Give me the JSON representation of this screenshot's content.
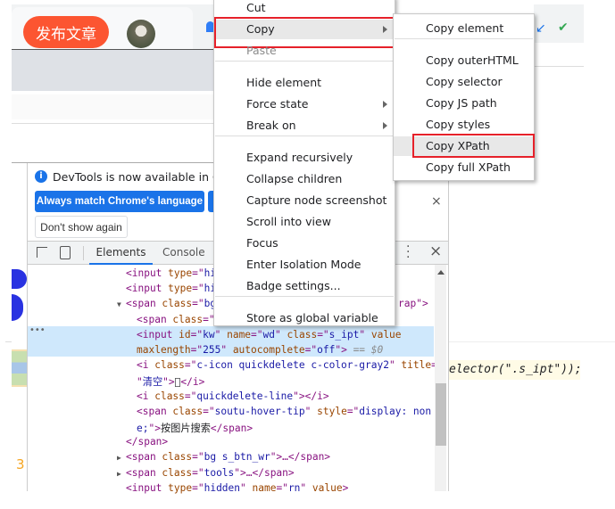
{
  "browser": {
    "publish_button": "发布文章"
  },
  "devtools": {
    "info_text": "DevTools is now available in Chine",
    "always_match_button": "Always match Chrome's language",
    "dont_show_button": "Don't show again",
    "tabs": [
      {
        "label": "Elements",
        "active": true
      },
      {
        "label": "Console",
        "active": false
      }
    ],
    "code_lines": [
      {
        "indent": 1,
        "tokens": [
          [
            "t",
            "<input "
          ],
          [
            "an",
            "type"
          ],
          [
            "t",
            "=\""
          ],
          [
            "av",
            "hi"
          ]
        ]
      },
      {
        "indent": 1,
        "tokens": [
          [
            "t",
            "<input "
          ],
          [
            "an",
            "type"
          ],
          [
            "t",
            "=\""
          ],
          [
            "av",
            "hi"
          ]
        ]
      },
      {
        "indent": 1,
        "expander": "open",
        "tokens": [
          [
            "t",
            "<span "
          ],
          [
            "an",
            "class"
          ],
          [
            "t",
            "=\""
          ],
          [
            "av",
            "bg"
          ]
        ],
        "tail": "rap\">"
      },
      {
        "indent": 2,
        "tokens": [
          [
            "t",
            "<span "
          ],
          [
            "an",
            "class"
          ],
          [
            "t",
            "=\""
          ]
        ]
      },
      {
        "indent": 2,
        "selected": true,
        "tokens": [
          [
            "t",
            "<input "
          ],
          [
            "an",
            "id"
          ],
          [
            "t",
            "=\""
          ],
          [
            "av",
            "kw"
          ],
          [
            "t",
            "\" "
          ],
          [
            "an",
            "name"
          ],
          [
            "t",
            "=\""
          ],
          [
            "av",
            "wd"
          ],
          [
            "t",
            "\" "
          ],
          [
            "an",
            "class"
          ],
          [
            "t",
            "=\""
          ],
          [
            "av",
            "s_ipt"
          ],
          [
            "t",
            "\" "
          ],
          [
            "an",
            "value"
          ]
        ]
      },
      {
        "indent": 2,
        "selected": true,
        "tokens": [
          [
            "an",
            "maxlength"
          ],
          [
            "t",
            "=\""
          ],
          [
            "av",
            "255"
          ],
          [
            "t",
            "\" "
          ],
          [
            "an",
            "autocomplete"
          ],
          [
            "t",
            "=\""
          ],
          [
            "av",
            "off"
          ],
          [
            "t",
            "\">"
          ],
          [
            "dim",
            " == $0"
          ]
        ]
      },
      {
        "indent": 2,
        "tokens": [
          [
            "t",
            "<i "
          ],
          [
            "an",
            "class"
          ],
          [
            "t",
            "=\""
          ],
          [
            "av",
            "c-icon quickdelete c-color-gray2"
          ],
          [
            "t",
            "\" "
          ],
          [
            "an",
            "title"
          ],
          [
            "t",
            "="
          ]
        ]
      },
      {
        "indent": 2,
        "tokens": [
          [
            "t",
            "\""
          ],
          [
            "av",
            "清空"
          ],
          [
            "t",
            "\">"
          ],
          [
            "tx",
            ""
          ],
          [
            "t",
            "</i>"
          ]
        ]
      },
      {
        "indent": 2,
        "tokens": [
          [
            "t",
            "<i "
          ],
          [
            "an",
            "class"
          ],
          [
            "t",
            "=\""
          ],
          [
            "av",
            "quickdelete-line"
          ],
          [
            "t",
            "\"></i>"
          ]
        ]
      },
      {
        "indent": 2,
        "tokens": [
          [
            "t",
            "<span "
          ],
          [
            "an",
            "class"
          ],
          [
            "t",
            "=\""
          ],
          [
            "av",
            "soutu-hover-tip"
          ],
          [
            "t",
            "\" "
          ],
          [
            "an",
            "style"
          ],
          [
            "t",
            "=\""
          ],
          [
            "av",
            "display: non"
          ]
        ]
      },
      {
        "indent": 2,
        "tokens": [
          [
            "av",
            "e;"
          ],
          [
            "t",
            "\">"
          ],
          [
            "tx",
            "按图片搜索"
          ],
          [
            "t",
            "</span>"
          ]
        ]
      },
      {
        "indent": 1,
        "tokens": [
          [
            "t",
            "</span>"
          ]
        ]
      },
      {
        "indent": 1,
        "expander": "closed",
        "tokens": [
          [
            "t",
            "<span "
          ],
          [
            "an",
            "class"
          ],
          [
            "t",
            "=\""
          ],
          [
            "av",
            "bg s_btn_wr"
          ],
          [
            "t",
            "\">…</span>"
          ]
        ]
      },
      {
        "indent": 1,
        "expander": "closed",
        "tokens": [
          [
            "t",
            "<span "
          ],
          [
            "an",
            "class"
          ],
          [
            "t",
            "=\""
          ],
          [
            "av",
            "tools"
          ],
          [
            "t",
            "\">…</span>"
          ]
        ]
      },
      {
        "indent": 1,
        "tokens": [
          [
            "t",
            "<input "
          ],
          [
            "an",
            "type"
          ],
          [
            "t",
            "=\""
          ],
          [
            "av",
            "hidden"
          ],
          [
            "t",
            "\" "
          ],
          [
            "an",
            "name"
          ],
          [
            "t",
            "=\""
          ],
          [
            "av",
            "rn"
          ],
          [
            "t",
            "\" "
          ],
          [
            "an",
            "value"
          ],
          [
            "t",
            ">"
          ]
        ]
      }
    ]
  },
  "console_snippet": "elector(\".s_ipt\"));",
  "left_page_number": "3",
  "context_menu": {
    "items": [
      {
        "label": "Cut"
      },
      {
        "label": "Copy",
        "submenu": true,
        "highlighted": true
      },
      {
        "label": "Paste",
        "disabled": true
      },
      {
        "sep": true
      },
      {
        "label": "Hide element"
      },
      {
        "label": "Force state",
        "submenu": true
      },
      {
        "label": "Break on",
        "submenu": true
      },
      {
        "sep": true
      },
      {
        "label": "Expand recursively"
      },
      {
        "label": "Collapse children"
      },
      {
        "label": "Capture node screenshot"
      },
      {
        "label": "Scroll into view"
      },
      {
        "label": "Focus"
      },
      {
        "label": "Enter Isolation Mode"
      },
      {
        "label": "Badge settings..."
      },
      {
        "sep": true
      },
      {
        "label": "Store as global variable"
      }
    ]
  },
  "copy_submenu": {
    "items": [
      {
        "label": "Copy element"
      },
      {
        "sep": true
      },
      {
        "label": "Copy outerHTML"
      },
      {
        "label": "Copy selector"
      },
      {
        "label": "Copy JS path"
      },
      {
        "label": "Copy styles"
      },
      {
        "label": "Copy XPath",
        "highlighted": true
      },
      {
        "label": "Copy full XPath"
      }
    ]
  },
  "colors": {
    "accent": "#1a73e8",
    "publish": "#fc5531",
    "highlight_box": "#e6212a",
    "selected_row": "#cfe8fc"
  }
}
